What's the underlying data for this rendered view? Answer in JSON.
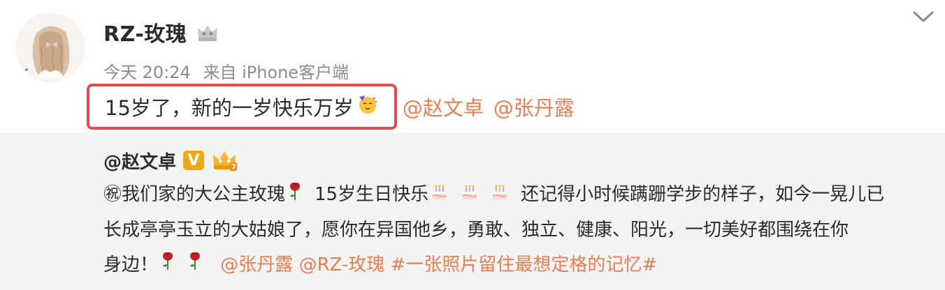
{
  "post": {
    "author": "RZ-玫瑰",
    "time": "今天 20:24",
    "source": "来自 iPhone客户端",
    "text": "15岁了，新的一岁快乐万岁",
    "mentions": [
      "@赵文卓",
      "@张丹露"
    ]
  },
  "repost": {
    "author": "@赵文卓",
    "verified_badge": "V",
    "lines": {
      "l1_pre": "㊗我们家的大公主玫瑰",
      "l1_mid": "15岁生日快乐",
      "l1_post": "还记得小时候蹒跚学步的样子，如今一晃儿已",
      "l2": "长成亭亭玉立的大姑娘了，愿你在异国他乡，勇敢、独立、健康、阳光，一切美好都围绕在你",
      "l3_pre": "身边！",
      "mention1": "@张丹露",
      "mention2": "@RZ-玫瑰",
      "hashtag": "#一张照片留住最想定格的记忆#"
    }
  },
  "colors": {
    "link": "#ea7e51",
    "highlight_border": "#e04b4f",
    "repost_bg": "#f3f3f3",
    "meta_text": "#8c8c8c",
    "v_badge": "#f0a81b"
  },
  "icons": {
    "avatar": "avatar-girl-illustration",
    "crown": "crown-badge-icon",
    "chevron": "chevron-down-icon",
    "party_face": "party-face-emoji",
    "rose": "rose-emoji",
    "cake": "birthday-cake-emoji",
    "gold_crown": "gold-crown-level-icon"
  }
}
